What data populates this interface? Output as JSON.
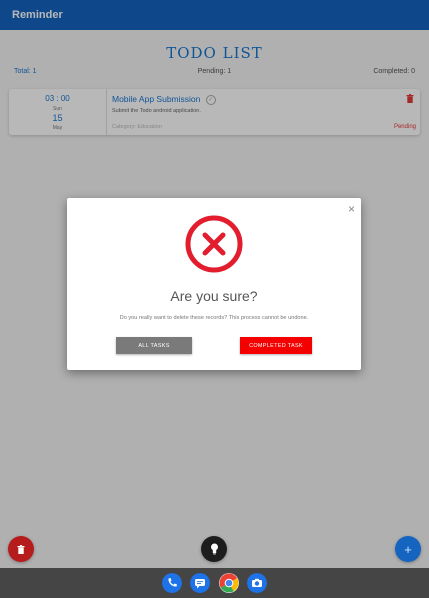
{
  "app": {
    "title": "Reminder"
  },
  "header": {
    "title": "TODO LIST",
    "total": "Total: 1",
    "pending": "Pending: 1",
    "completed": "Completed: 0"
  },
  "tasks": [
    {
      "time": "03 : 00",
      "day": "Sun",
      "date": "15",
      "month": "May",
      "title": "Mobile App Submission",
      "description": "Submit the Todo android application.",
      "category": "Category: Education",
      "status": "Pending"
    }
  ],
  "dialog": {
    "title": "Are you sure?",
    "message": "Do you really want to delete these records? This process cannot be undone.",
    "all_tasks_label": "ALL TASKS",
    "completed_task_label": "COMPLETED TASK",
    "close_label": "×"
  },
  "fab": {
    "add_label": "+"
  },
  "colors": {
    "primary": "#1565c0",
    "danger": "#f40000",
    "delete_fab": "#b71c1c"
  },
  "icons": {
    "dock": [
      "phone-icon",
      "messages-icon",
      "chrome-icon",
      "camera-icon"
    ]
  }
}
